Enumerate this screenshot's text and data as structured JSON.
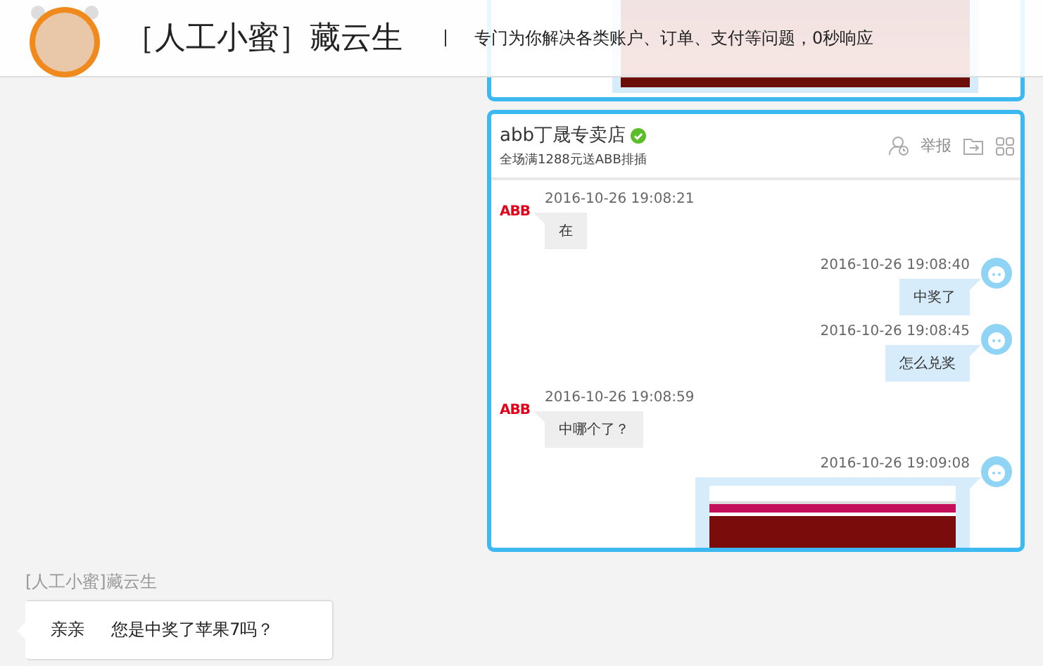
{
  "header": {
    "title": "［人工小蜜］藏云生",
    "tagline": "专门为你解决各类账户、订单、支付等问题，0秒响应"
  },
  "previous_card": {
    "kind": "image"
  },
  "chat_card": {
    "shop_name": "abb丁晟专卖店",
    "verified": true,
    "subtitle": "全场满1288元送ABB排插",
    "actions": [
      {
        "kind": "contact"
      },
      {
        "kind": "report",
        "label": "举报"
      },
      {
        "kind": "export"
      },
      {
        "kind": "apps"
      }
    ],
    "messages": [
      {
        "outgoing": false,
        "avatar_text": "ABB",
        "time": "2016-10-26 19:08:21",
        "kind": "text",
        "text": "在"
      },
      {
        "outgoing": true,
        "time": "2016-10-26 19:08:40",
        "kind": "text",
        "text": "中奖了"
      },
      {
        "outgoing": true,
        "time": "2016-10-26 19:08:45",
        "kind": "text",
        "text": "怎么兑奖"
      },
      {
        "outgoing": false,
        "avatar_text": "ABB",
        "time": "2016-10-26 19:08:59",
        "kind": "text",
        "text": "中哪个了？"
      },
      {
        "outgoing": true,
        "time": "2016-10-26 19:09:08",
        "kind": "image"
      }
    ]
  },
  "agent_message": {
    "sender": "[人工小蜜]藏云生",
    "text": "亲亲     您是中奖了苹果7吗？"
  }
}
